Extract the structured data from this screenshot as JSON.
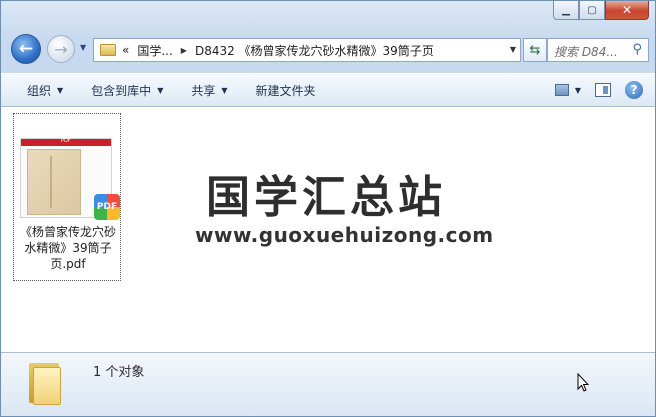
{
  "window": {
    "caption_buttons": [
      "minimize",
      "maximize",
      "close"
    ]
  },
  "nav": {
    "breadcrumb": {
      "overflow": "«",
      "items": [
        "国学...",
        "D8432 《杨曾家传龙穴砂水精微》39筒子页"
      ]
    },
    "search_placeholder": "搜索 D84..."
  },
  "toolbar": {
    "organize": "组织",
    "include_in_library": "包含到库中",
    "share": "共享",
    "new_folder": "新建文件夹"
  },
  "content": {
    "file": {
      "name": "《杨曾家传龙穴砂水精微》39筒子页.pdf",
      "badge": "PDF",
      "thumb_header": "PDF"
    },
    "watermark": {
      "title": "国学汇总站",
      "url": "www.guoxuehuizong.com"
    }
  },
  "details": {
    "count": "1 个对象"
  }
}
